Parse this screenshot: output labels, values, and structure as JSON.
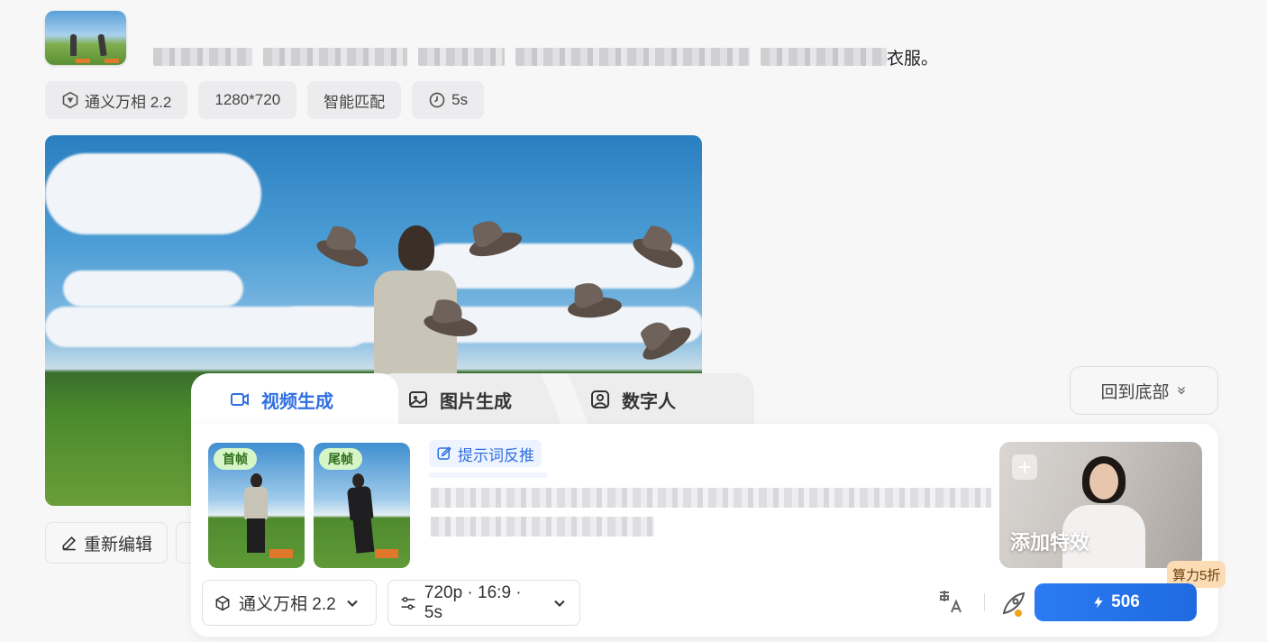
{
  "message": {
    "prompt_visible_tail": "衣服。"
  },
  "params": {
    "model": "通义万相 2.2",
    "resolution": "1280*720",
    "ratio": "智能匹配",
    "duration": "5s"
  },
  "actions": {
    "re_edit": "重新编辑",
    "back_to_bottom": "回到底部"
  },
  "composer": {
    "tabs": [
      {
        "label": "视频生成",
        "active": true
      },
      {
        "label": "图片生成",
        "active": false
      },
      {
        "label": "数字人",
        "active": false
      }
    ],
    "first_frame_label": "首帧",
    "last_frame_label": "尾帧",
    "reverse_prompt": "提示词反推",
    "effect_label": "添加特效",
    "discount": "算力5折",
    "model_select": "通义万相 2.2",
    "settings_select": "720p · 16:9 · 5s",
    "generate_cost": "506"
  },
  "colors": {
    "accent": "#2b7bf2",
    "tab_active": "#2f6fe0"
  }
}
